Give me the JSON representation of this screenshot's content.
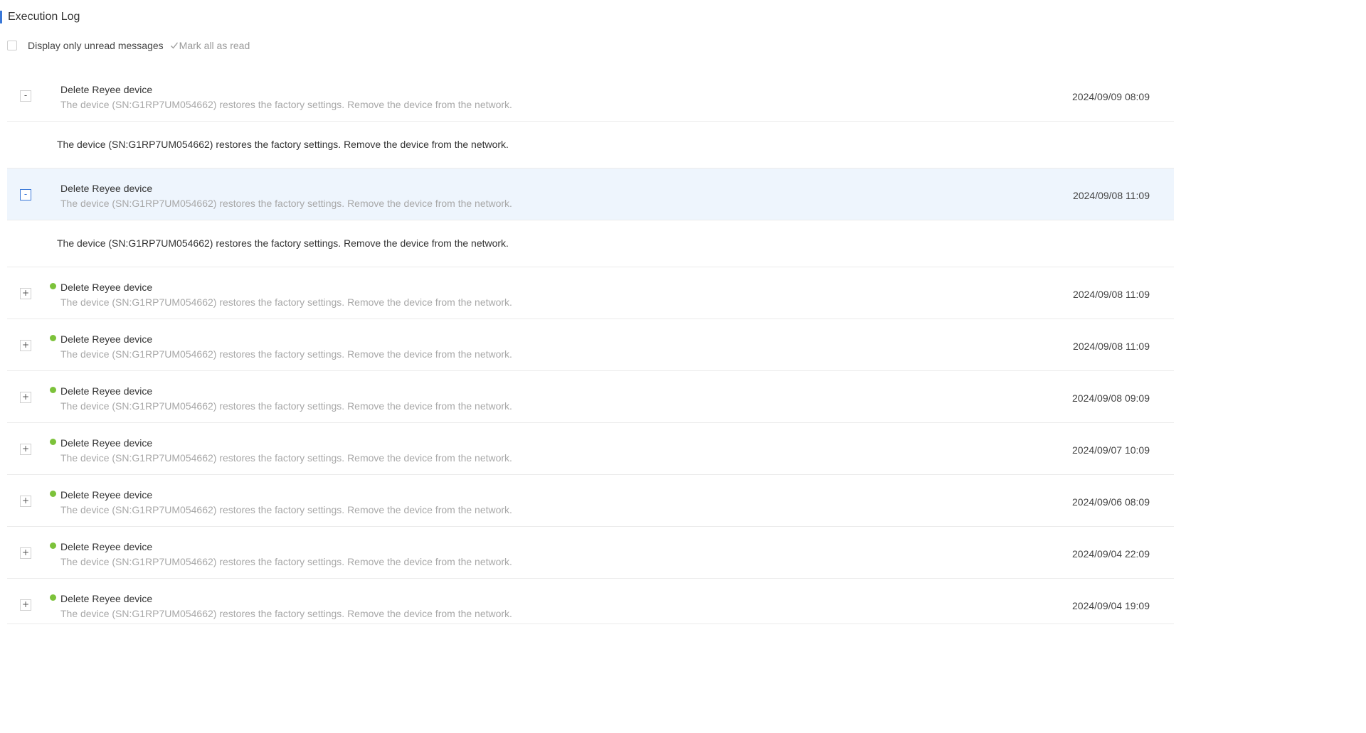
{
  "header": {
    "title": "Execution Log"
  },
  "toolbar": {
    "filter_label": "Display only unread messages",
    "mark_all_label": "Mark all as read"
  },
  "colors": {
    "accent": "#3a78d8",
    "unread_dot": "#7cc23a",
    "highlight_row": "#eef5fd"
  },
  "entries": [
    {
      "title": "Delete Reyee device",
      "description": "The device (SN:G1RP7UM054662) restores the factory settings. Remove the device from the network.",
      "time": "2024/09/09 08:09",
      "expanded": true,
      "unread": false,
      "toggle": "-",
      "detail": "The device (SN:G1RP7UM054662) restores the factory settings. Remove the device from the network."
    },
    {
      "title": "Delete Reyee device",
      "description": "The device (SN:G1RP7UM054662) restores the factory settings. Remove the device from the network.",
      "time": "2024/09/08 11:09",
      "expanded": true,
      "unread": false,
      "toggle": "-",
      "detail": "The device (SN:G1RP7UM054662) restores the factory settings. Remove the device from the network."
    },
    {
      "title": "Delete Reyee device",
      "description": "The device (SN:G1RP7UM054662) restores the factory settings. Remove the device from the network.",
      "time": "2024/09/08 11:09",
      "expanded": false,
      "unread": true,
      "toggle": "+"
    },
    {
      "title": "Delete Reyee device",
      "description": "The device (SN:G1RP7UM054662) restores the factory settings. Remove the device from the network.",
      "time": "2024/09/08 11:09",
      "expanded": false,
      "unread": true,
      "toggle": "+"
    },
    {
      "title": "Delete Reyee device",
      "description": "The device (SN:G1RP7UM054662) restores the factory settings. Remove the device from the network.",
      "time": "2024/09/08 09:09",
      "expanded": false,
      "unread": true,
      "toggle": "+"
    },
    {
      "title": "Delete Reyee device",
      "description": "The device (SN:G1RP7UM054662) restores the factory settings. Remove the device from the network.",
      "time": "2024/09/07 10:09",
      "expanded": false,
      "unread": true,
      "toggle": "+"
    },
    {
      "title": "Delete Reyee device",
      "description": "The device (SN:G1RP7UM054662) restores the factory settings. Remove the device from the network.",
      "time": "2024/09/06 08:09",
      "expanded": false,
      "unread": true,
      "toggle": "+"
    },
    {
      "title": "Delete Reyee device",
      "description": "The device (SN:G1RP7UM054662) restores the factory settings. Remove the device from the network.",
      "time": "2024/09/04 22:09",
      "expanded": false,
      "unread": true,
      "toggle": "+"
    },
    {
      "title": "Delete Reyee device",
      "description": "The device (SN:G1RP7UM054662) restores the factory settings. Remove the device from the network.",
      "time": "2024/09/04 19:09",
      "expanded": false,
      "unread": true,
      "toggle": "+"
    }
  ]
}
